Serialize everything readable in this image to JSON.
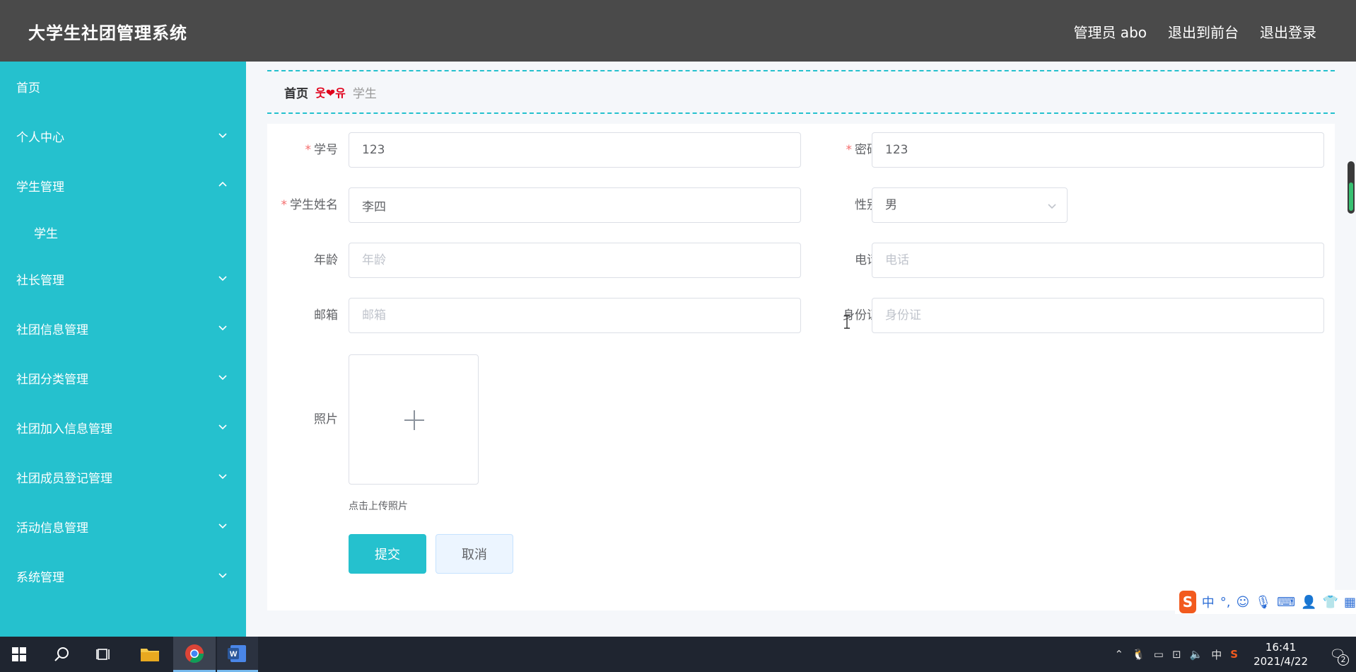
{
  "header": {
    "app_title": "大学生社团管理系统",
    "admin_label": "管理员 abo",
    "to_front": "退出到前台",
    "logout": "退出登录"
  },
  "sidebar": {
    "items": [
      {
        "label": "首页"
      },
      {
        "label": "个人中心"
      },
      {
        "label": "学生管理"
      },
      {
        "label": "学生"
      },
      {
        "label": "社长管理"
      },
      {
        "label": "社团信息管理"
      },
      {
        "label": "社团分类管理"
      },
      {
        "label": "社团加入信息管理"
      },
      {
        "label": "社团成员登记管理"
      },
      {
        "label": "活动信息管理"
      },
      {
        "label": "系统管理"
      }
    ]
  },
  "breadcrumb": {
    "home": "首页",
    "separator": "웃❤유",
    "current": "学生"
  },
  "form": {
    "student_no_label": "学号",
    "student_no_value": "123",
    "password_label": "密码",
    "password_value": "123",
    "name_label": "学生姓名",
    "name_value": "李四",
    "gender_label": "性别",
    "gender_value": "男",
    "age_label": "年龄",
    "age_placeholder": "年龄",
    "phone_label": "电话",
    "phone_placeholder": "电话",
    "email_label": "邮箱",
    "email_placeholder": "邮箱",
    "idcard_label": "身份证",
    "idcard_placeholder": "身份证",
    "photo_label": "照片",
    "upload_tip": "点击上传照片",
    "required_mark": "*",
    "submit": "提交",
    "cancel": "取消"
  },
  "ime": {
    "logo": "S",
    "mode": "中",
    "punct": "°,"
  },
  "taskbar": {
    "time": "16:41",
    "date": "2021/4/22",
    "input_lang": "中",
    "notifications": "2"
  },
  "colors": {
    "header_bg": "#4a4a4a",
    "sidebar_bg": "#25c1ce",
    "accent": "#25c1ce",
    "required": "#f56c6c"
  }
}
